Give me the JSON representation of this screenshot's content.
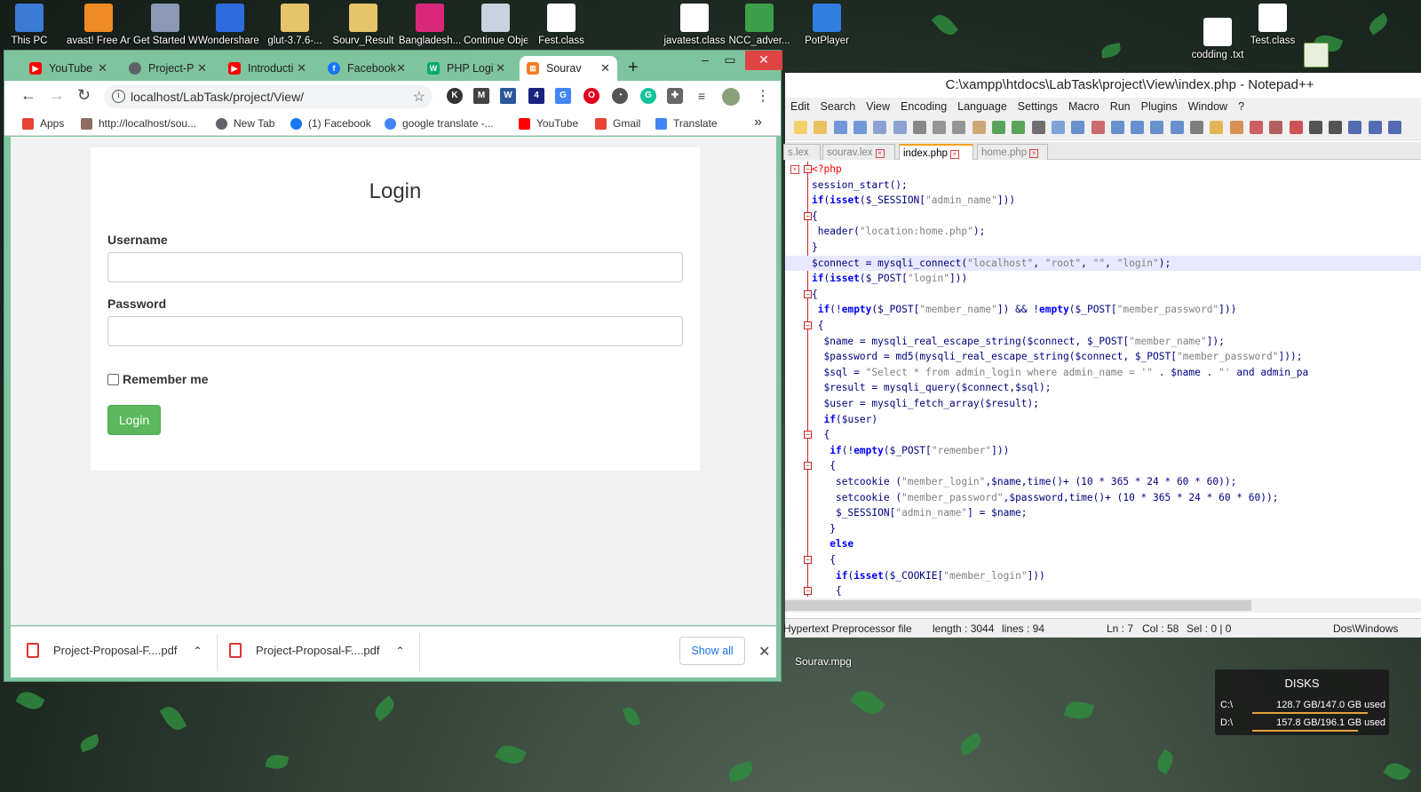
{
  "desktop": {
    "icons": [
      {
        "label": "This PC",
        "color": "#3a7bd5"
      },
      {
        "label": "avast! Free Antivirus",
        "color": "#f08a24"
      },
      {
        "label": "Get Started With Oracl...",
        "color": "#8a99b4"
      },
      {
        "label": "Wondershare Filmora",
        "color": "#2d6cdf"
      },
      {
        "label": "glut-3.7.6-...",
        "color": "#e7c46a"
      },
      {
        "label": "Sourv_Result",
        "color": "#e7c46a"
      },
      {
        "label": "Bangladesh...",
        "color": "#d9287a"
      },
      {
        "label": "Continue ObjectRe...",
        "color": "#c8d2e0"
      },
      {
        "label": "Fest.class",
        "color": "#ffffff"
      },
      {
        "label": "javatest.class",
        "color": "#ffffff"
      },
      {
        "label": "NCC_adver...",
        "color": "#3ca04a"
      },
      {
        "label": "PotPlayer",
        "color": "#2f7ee0"
      },
      {
        "label": "codding .txt",
        "color": "#ffffff"
      },
      {
        "label": "Test.class",
        "color": "#ffffff"
      }
    ],
    "video_file": "Sourav.mpg"
  },
  "chrome": {
    "tabs": [
      {
        "label": "YouTube",
        "icon": "youtube-icon",
        "color": "#ff0000"
      },
      {
        "label": "Project-P",
        "icon": "globe-icon",
        "color": "#5f6368"
      },
      {
        "label": "Introducti",
        "icon": "youtube-icon",
        "color": "#ff0000"
      },
      {
        "label": "Facebook",
        "icon": "facebook-icon",
        "color": "#1877f2"
      },
      {
        "label": "PHP Logi",
        "icon": "w3-icon",
        "color": "#04aa6d"
      },
      {
        "label": "Sourav",
        "icon": "xampp-icon",
        "color": "#fb7a24"
      }
    ],
    "new_tab": "+",
    "url": "localhost/LabTask/project/View/",
    "bookmarks": [
      {
        "label": "Apps",
        "color": "#ea4335"
      },
      {
        "label": "http://localhost/sou...",
        "color": "#8d6e63"
      },
      {
        "label": "New Tab",
        "color": "#5f6368"
      },
      {
        "label": "(1) Facebook",
        "color": "#1877f2"
      },
      {
        "label": "google translate -...",
        "color": "#4285f4"
      },
      {
        "label": "YouTube",
        "color": "#ff0000"
      },
      {
        "label": "Gmail",
        "color": "#ea4335"
      },
      {
        "label": "Translate",
        "color": "#4285f4"
      }
    ],
    "bookmarks_more": "»",
    "page": {
      "title": "Login",
      "username_label": "Username",
      "password_label": "Password",
      "remember_label": "Remember me",
      "login_button": "Login"
    },
    "downloads": {
      "items": [
        "Project-Proposal-F....pdf",
        "Project-Proposal-F....pdf"
      ],
      "show_all": "Show all"
    }
  },
  "npp": {
    "title": "C:\\xampp\\htdocs\\LabTask\\project\\View\\index.php - Notepad++",
    "menu": [
      "Edit",
      "Search",
      "View",
      "Encoding",
      "Language",
      "Settings",
      "Macro",
      "Run",
      "Plugins",
      "Window",
      "?"
    ],
    "tabs": [
      "s.lex",
      "sourav.lex",
      "index.php",
      "home.php"
    ],
    "active_tab": "index.php",
    "code": [
      "<?php",
      "session_start();",
      "if(isset($_SESSION[\"admin_name\"]))",
      "{",
      " header(\"location:home.php\");",
      "}",
      "$connect = mysqli_connect(\"localhost\", \"root\", \"\", \"login\");",
      "if(isset($_POST[\"login\"]))",
      "{",
      " if(!empty($_POST[\"member_name\"]) && !empty($_POST[\"member_password\"]))",
      " {",
      "  $name = mysqli_real_escape_string($connect, $_POST[\"member_name\"]);",
      "  $password = md5(mysqli_real_escape_string($connect, $_POST[\"member_password\"]));",
      "  $sql = \"Select * from admin_login where admin_name = '\" . $name . \"' and admin_pa",
      "  $result = mysqli_query($connect,$sql);",
      "  $user = mysqli_fetch_array($result);",
      "  if($user)",
      "  {",
      "   if(!empty($_POST[\"remember\"]))",
      "   {",
      "    setcookie (\"member_login\",$name,time()+ (10 * 365 * 24 * 60 * 60));",
      "    setcookie (\"member_password\",$password,time()+ (10 * 365 * 24 * 60 * 60));",
      "    $_SESSION[\"admin_name\"] = $name;",
      "   }",
      "   else",
      "   {",
      "    if(isset($_COOKIE[\"member_login\"]))",
      "    {"
    ],
    "status": {
      "filetype": "Hypertext Preprocessor file",
      "length": "length : 3044",
      "lines": "lines : 94",
      "ln": "Ln : 7",
      "col": "Col : 58",
      "sel": "Sel : 0 | 0",
      "eol": "Dos\\Windows"
    }
  },
  "disks": {
    "title": "DISKS",
    "drives": [
      {
        "name": "C:\\",
        "usage": "128.7 GB/147.0 GB used",
        "fraction": 0.876
      },
      {
        "name": "D:\\",
        "usage": "157.8 GB/196.1 GB used",
        "fraction": 0.805
      }
    ]
  }
}
